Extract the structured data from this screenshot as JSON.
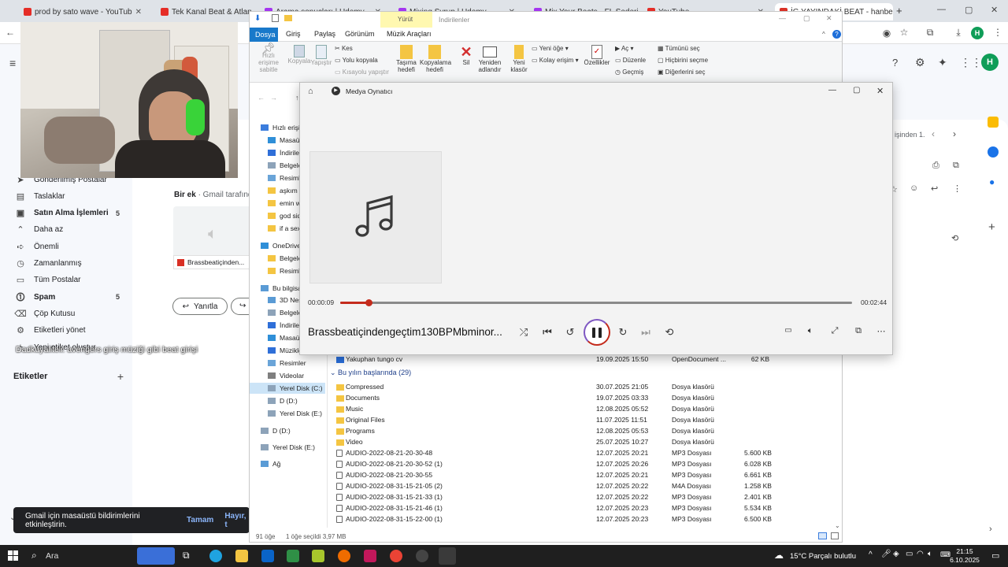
{
  "browser": {
    "tabs": [
      {
        "label": "prod by sato wave - YouTub",
        "color": "#e52d27"
      },
      {
        "label": "Tek Kanal Beat & Atlanta Trap",
        "color": "#e52d27"
      },
      {
        "label": "Arama sonuçları | Udemy",
        "color": "#a435f0"
      },
      {
        "label": "Mixing Syrup | Udemy",
        "color": "#a435f0"
      },
      {
        "label": "Mix Your Beats - FL Sederi | U",
        "color": "#a435f0"
      },
      {
        "label": "YouTube",
        "color": "#e52d27"
      },
      {
        "label": "İG YAYINDAKİ BEAT - hanbenlp",
        "color": "#d93025"
      }
    ],
    "profile_initial": "H"
  },
  "gmail": {
    "sidebar": [
      {
        "label": "Gönderilmiş Postalar",
        "icon": "send-icon",
        "count": ""
      },
      {
        "label": "Taslaklar",
        "icon": "draft-icon",
        "count": ""
      },
      {
        "label": "Satın Alma İşlemleri",
        "icon": "shopping-bag-icon",
        "count": "5",
        "bold": true
      },
      {
        "label": "Daha az",
        "icon": "chevron-up-icon",
        "count": ""
      },
      {
        "label": "Önemli",
        "icon": "important-icon",
        "count": ""
      },
      {
        "label": "Zamanlanmış",
        "icon": "scheduled-icon",
        "count": ""
      },
      {
        "label": "Tüm Postalar",
        "icon": "all-mail-icon",
        "count": ""
      },
      {
        "label": "Spam",
        "icon": "spam-icon",
        "count": "5",
        "bold": true
      },
      {
        "label": "Çöp Kutusu",
        "icon": "trash-icon",
        "count": ""
      },
      {
        "label": "Etiketleri yönet",
        "icon": "gear-icon",
        "count": ""
      },
      {
        "label": "Yeni etiket oluştur",
        "icon": "plus-icon",
        "count": ""
      }
    ],
    "labels_heading": "Etiketler",
    "attachment_header": "Bir ek",
    "attachment_sub": "· Gmail tarafınd",
    "attachment_name": "Brassbeatiçinden...",
    "reply_label": "Yanıtla",
    "pagination": "işinden 1.",
    "toast_text": "Gmail için masaüstü bildirimlerini etkinleştirin.",
    "toast_ok": "Tamam",
    "toast_no": "Hayır, t"
  },
  "overlay_chat": "Dadkuyaliteli: avengers giriş müziği gibi beat girişi",
  "explorer": {
    "ribbon_tabs": [
      "Dosya",
      "Giriş",
      "Paylaş",
      "Görünüm",
      "Müzik Araçları"
    ],
    "context_tab": "Yürüt",
    "window_title": "İndirilenler",
    "ribbon_buttons": [
      "Hızlı erişime sabitle",
      "Kopyala",
      "Yapıştır",
      "Taşıma hedefi",
      "Kopyalama hedefi",
      "Sil",
      "Yeniden adlandır",
      "Yeni klasör",
      "Özellikler"
    ],
    "ribbon_small": [
      "Kes",
      "Yolu kopyala",
      "Kısayolu yapıştır",
      "Yeni öğe",
      "Kolay erişim",
      "Aç",
      "Düzenle",
      "Geçmiş",
      "Tümünü seç",
      "Hiçbirini seçme",
      "Diğerlerini seç"
    ],
    "nav": [
      {
        "label": "Hızlı erişim",
        "color": "#3b7ddd"
      },
      {
        "label": "Masaüst",
        "color": "#2f8fd8"
      },
      {
        "label": "İndirilen",
        "color": "#2f6fd8"
      },
      {
        "label": "Belgeler",
        "color": "#8da3b9"
      },
      {
        "label": "Resimler",
        "color": "#6aa4d8"
      },
      {
        "label": "aşkım ç",
        "color": "#f4c542"
      },
      {
        "label": "emin we",
        "color": "#f4c542"
      },
      {
        "label": "god side",
        "color": "#f4c542"
      },
      {
        "label": "if a sex",
        "color": "#f4c542"
      },
      {
        "label": "OneDrive",
        "color": "#2f8fd8"
      },
      {
        "label": "Belgeler",
        "color": "#f4c542"
      },
      {
        "label": "Resimler",
        "color": "#f4c542"
      },
      {
        "label": "Bu bilgisa",
        "color": "#5a9bd5"
      },
      {
        "label": "3D Nesn",
        "color": "#5a9bd5"
      },
      {
        "label": "Belgeler",
        "color": "#8da3b9"
      },
      {
        "label": "İndirilen",
        "color": "#2f6fd8"
      },
      {
        "label": "Masaüst",
        "color": "#2f8fd8"
      },
      {
        "label": "Müzikler",
        "color": "#2f6fd8"
      },
      {
        "label": "Resimler",
        "color": "#6aa4d8"
      },
      {
        "label": "Videolar",
        "color": "#7f7f7f"
      },
      {
        "label": "Yerel Disk (C:)",
        "color": "#8da3b9"
      },
      {
        "label": "D (D:)",
        "color": "#8da3b9"
      },
      {
        "label": "Yerel Disk (E:)",
        "color": "#8da3b9"
      },
      {
        "label": "D (D:)",
        "color": "#8da3b9"
      },
      {
        "label": "Yerel Disk (E:)",
        "color": "#8da3b9"
      },
      {
        "label": "Ağ",
        "color": "#5a9bd5"
      }
    ],
    "partial_file": {
      "name": "Yakuphan tungo cv",
      "date": "19.09.2025 15:50",
      "type": "OpenDocument ...",
      "size": "62 KB"
    },
    "group_label": "Bu yılın başlarında (29)",
    "files": [
      {
        "name": "Compressed",
        "date": "30.07.2025 21:05",
        "type": "Dosya klasörü",
        "size": "",
        "kind": "folder"
      },
      {
        "name": "Documents",
        "date": "19.07.2025 03:33",
        "type": "Dosya klasörü",
        "size": "",
        "kind": "folder"
      },
      {
        "name": "Music",
        "date": "12.08.2025 05:52",
        "type": "Dosya klasörü",
        "size": "",
        "kind": "folder"
      },
      {
        "name": "Original Files",
        "date": "11.07.2025 11:51",
        "type": "Dosya klasörü",
        "size": "",
        "kind": "folder"
      },
      {
        "name": "Programs",
        "date": "12.08.2025 05:53",
        "type": "Dosya klasörü",
        "size": "",
        "kind": "folder"
      },
      {
        "name": "Video",
        "date": "25.07.2025 10:27",
        "type": "Dosya klasörü",
        "size": "",
        "kind": "folder"
      },
      {
        "name": "AUDIO-2022-08-21-20-30-48",
        "date": "12.07.2025 20:21",
        "type": "MP3 Dosyası",
        "size": "5.600 KB",
        "kind": "mp3"
      },
      {
        "name": "AUDIO-2022-08-21-20-30-52 (1)",
        "date": "12.07.2025 20:26",
        "type": "MP3 Dosyası",
        "size": "6.028 KB",
        "kind": "mp3"
      },
      {
        "name": "AUDIO-2022-08-21-20-30-55",
        "date": "12.07.2025 20:21",
        "type": "MP3 Dosyası",
        "size": "6.661 KB",
        "kind": "mp3"
      },
      {
        "name": "AUDIO-2022-08-31-15-21-05 (2)",
        "date": "12.07.2025 20:22",
        "type": "M4A Dosyası",
        "size": "1.258 KB",
        "kind": "mp3"
      },
      {
        "name": "AUDIO-2022-08-31-15-21-33 (1)",
        "date": "12.07.2025 20:22",
        "type": "MP3 Dosyası",
        "size": "2.401 KB",
        "kind": "mp3"
      },
      {
        "name": "AUDIO-2022-08-31-15-21-46 (1)",
        "date": "12.07.2025 20:23",
        "type": "MP3 Dosyası",
        "size": "5.534 KB",
        "kind": "mp3"
      },
      {
        "name": "AUDIO-2022-08-31-15-22-00 (1)",
        "date": "12.07.2025 20:23",
        "type": "MP3 Dosyası",
        "size": "6.500 KB",
        "kind": "mp3"
      }
    ],
    "status_count": "91 öğe",
    "status_selected": "1 öğe seçildi  3,97 MB"
  },
  "player": {
    "title": "Medya Oynatıcı",
    "track": "Brassbeatiçindengeçtim130BPMbminor...",
    "elapsed": "00:00:09",
    "total": "00:02:44",
    "progress": 0.055,
    "accent": "#c42b1c"
  },
  "taskbar": {
    "search": "Ara",
    "weather": "15°C  Parçalı bulutlu",
    "time": "21:15",
    "date": "6.10.2025"
  }
}
